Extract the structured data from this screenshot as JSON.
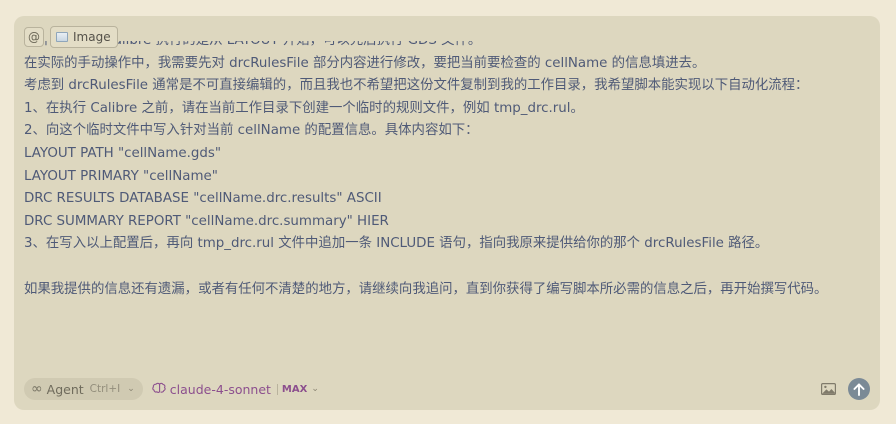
{
  "composer": {
    "mention_symbol": "@",
    "attachment_chip": {
      "label": "Image",
      "icon": "image-icon"
    },
    "lines": [
      "文件。因此，Calibre 执行的是从 LAYOUT 开始，可以先后执行 GDS 文件。",
      "在实际的手动操作中，我需要先对 drcRulesFile 部分内容进行修改，要把当前要检查的 cellName 的信息填进去。",
      "考虑到 drcRulesFile 通常是不可直接编辑的，而且我也不希望把这份文件复制到我的工作目录，我希望脚本能实现以下自动化流程：",
      "1、在执行 Calibre 之前，请在当前工作目录下创建一个临时的规则文件，例如 tmp_drc.rul。",
      "2、向这个临时文件中写入针对当前 cellName 的配置信息。具体内容如下：",
      "LAYOUT PATH \"cellName.gds\"",
      "LAYOUT PRIMARY \"cellName\"",
      "DRC RESULTS DATABASE \"cellName.drc.results\" ASCII",
      "DRC SUMMARY REPORT \"cellName.drc.summary\" HIER",
      "3、在写入以上配置后，再向 tmp_drc.rul 文件中追加一条 INCLUDE 语句，指向我原来提供给你的那个 drcRulesFile 路径。",
      "",
      "如果我提供的信息还有遗漏，或者有任何不清楚的地方，请继续向我追问，直到你获得了编写脚本所必需的信息之后，再开始撰写代码。"
    ]
  },
  "toolbar": {
    "agent_label": "Agent",
    "agent_shortcut": "Ctrl+I",
    "agent_icon": "infinity-icon",
    "model_label": "claude-4-sonnet",
    "model_badge": "MAX",
    "model_icon": "brain-icon",
    "image_button_icon": "image-icon",
    "send_button_icon": "arrow-up-icon"
  },
  "colors": {
    "page_bg": "#f0e9d6",
    "composer_bg": "#ddd7bf",
    "text": "#4f5a77",
    "model_accent": "#8c4f8e",
    "send_bg": "#7b8a96"
  }
}
